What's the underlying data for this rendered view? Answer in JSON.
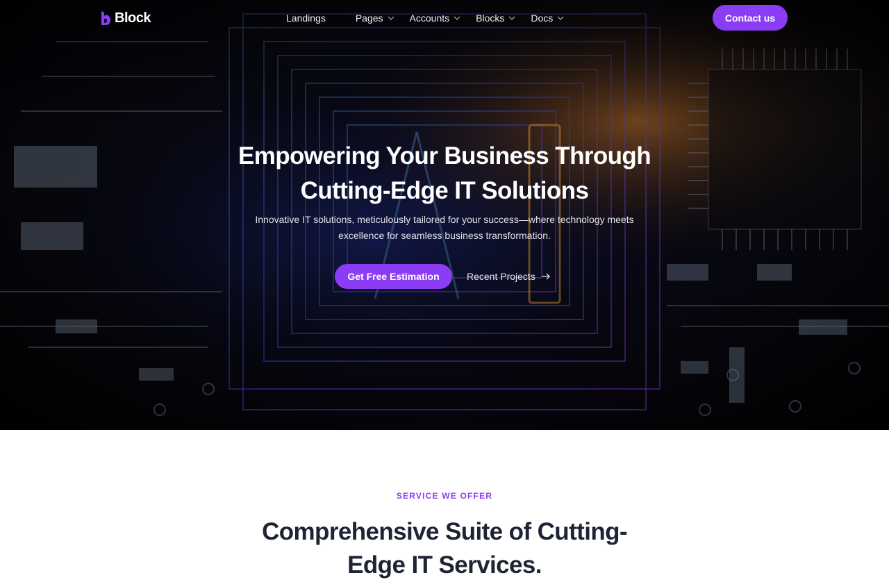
{
  "nav": {
    "brand": "Block",
    "menu": [
      {
        "label": "Landings",
        "has_dropdown": false
      },
      {
        "label": "Pages",
        "has_dropdown": true
      },
      {
        "label": "Accounts",
        "has_dropdown": true
      },
      {
        "label": "Blocks",
        "has_dropdown": true
      },
      {
        "label": "Docs",
        "has_dropdown": true
      }
    ],
    "contact_label": "Contact us"
  },
  "hero": {
    "title_line1": "Empowering Your Business Through",
    "title_line2": "Cutting-Edge IT Solutions",
    "subtitle_line1": "Innovative IT solutions, meticulously tailored for your success—where technology meets",
    "subtitle_line2": "excellence for seamless business transformation.",
    "primary_cta": "Get Free Estimation",
    "secondary_cta": "Recent Projects",
    "secondary_icon": "arrow-right-icon",
    "background_image": "circuit-board-image"
  },
  "services": {
    "eyebrow": "SERVICE WE OFFER",
    "title_line1": "Comprehensive Suite of Cutting-",
    "title_line2": "Edge IT Services."
  },
  "colors": {
    "accent": "#8b3df5",
    "hero_text": "#ffffff",
    "heading_dark": "#1e2433"
  }
}
